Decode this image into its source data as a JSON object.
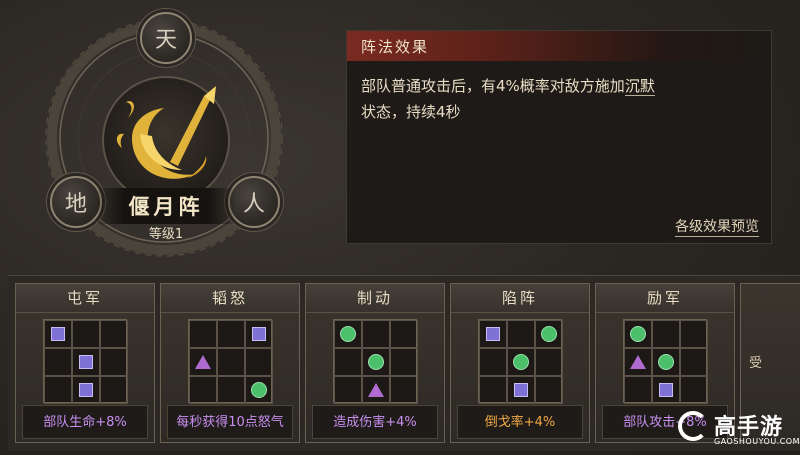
{
  "formation": {
    "name": "偃月阵",
    "level": "等级1",
    "nodes": {
      "top": "天",
      "left": "地",
      "right": "人"
    }
  },
  "effect": {
    "header": "阵法效果",
    "text_before": "部队普通攻击后，有4%概率对敌方施加",
    "text_highlight": "沉默",
    "text_after": "状态，持续4秒",
    "link": "各级效果预览"
  },
  "cards": [
    {
      "title": "屯军",
      "bonus": "部队生命+8%",
      "bonus_color": "purple",
      "grid": [
        "square",
        "",
        "",
        "",
        "square",
        "",
        "",
        "square",
        ""
      ]
    },
    {
      "title": "韬怒",
      "bonus": "每秒获得10点怒气",
      "bonus_color": "purple",
      "grid": [
        "",
        "",
        "square",
        "triangle",
        "",
        "",
        "",
        "",
        "circle"
      ]
    },
    {
      "title": "制动",
      "bonus": "造成伤害+4%",
      "bonus_color": "purple",
      "grid": [
        "circle",
        "",
        "",
        "",
        "circle",
        "",
        "",
        "triangle",
        ""
      ]
    },
    {
      "title": "陷阵",
      "bonus": "倒戈率+4%",
      "bonus_color": "orange",
      "grid": [
        "square",
        "",
        "circle",
        "",
        "circle",
        "",
        "",
        "square",
        ""
      ]
    },
    {
      "title": "励军",
      "bonus": "部队攻击+8%",
      "bonus_color": "purple",
      "grid": [
        "circle",
        "",
        "",
        "triangle",
        "circle",
        "",
        "",
        "square",
        ""
      ]
    }
  ],
  "partial_card": {
    "stub": "受"
  },
  "colors": {
    "square": "#7f70d6",
    "circle": "#4bbf6a",
    "triangle": "#b06bd0",
    "header_red": "#7a2a20",
    "gold": "#e2b33a"
  },
  "watermark": {
    "brand": "高手游",
    "url": "GAOSHOUYOU.COM"
  }
}
